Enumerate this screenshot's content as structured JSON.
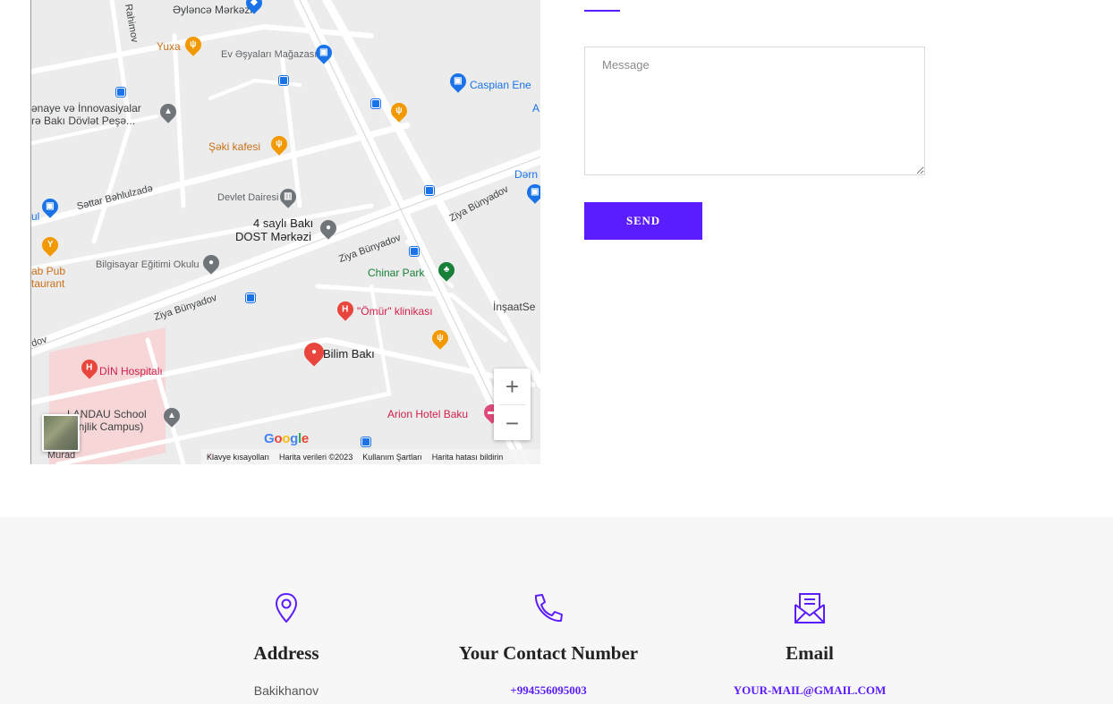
{
  "map": {
    "places": {
      "eylence_merkezi": "Əylәncә Mәrkәzi",
      "yuxa": "Yuxa",
      "ev_esyalari": "Ev Əşyaları Mağazası",
      "caspian": "Caspian Ene",
      "innovasiya_1": "ənaye və İnnovasiyalar",
      "innovasiya_2": "rə Bakı Dövlət Peşə...",
      "seki_kafesi": "Şəki kafesi",
      "devlet_dairesi": "Devlet Dairesi",
      "dost_1": "4 saylı Bakı",
      "dost_2": "DOST Mərkəzi",
      "bilgisayar": "Bilgisayar Eğitimi Okulu",
      "pub_1": "ab Pub",
      "pub_2": "taurant",
      "chinar_park": "Chinar Park",
      "omur": "\"Ömür\" klinikası",
      "bilim_baki": "Bilim Bakı",
      "din_hospital": "DİN Hospitalı",
      "insaat": "İnşaatSe",
      "landau_1": "LANDAU School",
      "landau_2": "anjlik Campus)",
      "arion": "Arion Hotel Baku",
      "dern": "Dərn",
      "rahimov": "Rahimov",
      "settar": "Səttar Bəhlulzadə",
      "ziya_1": "Ziya Bünyadov",
      "ziya_2": "Ziya Bünyadov",
      "ziya_3": "Ziya Bünyadov",
      "dov": "dov",
      "murad": "Murad",
      "edge_a": "A",
      "edge_ul": "ul",
      "edge_a2": "A"
    },
    "zoom_in": "+",
    "zoom_out": "−",
    "google": [
      "G",
      "o",
      "o",
      "g",
      "l",
      "e"
    ],
    "footer": {
      "shortcuts": "Klavye kısayolları",
      "map_data": "Harita verileri ©2023",
      "terms": "Kullanım Şartları",
      "report": "Harita hatası bildirin"
    }
  },
  "form": {
    "message_placeholder": "Message",
    "send_label": "SEND"
  },
  "contact": {
    "address": {
      "title": "Address",
      "value": "Bakikhanov"
    },
    "phone": {
      "title": "Your Contact Number",
      "value": "+994556095003"
    },
    "email": {
      "title": "Email",
      "value": "YOUR-MAIL@GMAIL.COM"
    }
  },
  "colors": {
    "accent": "#5b1dff",
    "strip_bg": "#f7f7f7"
  }
}
